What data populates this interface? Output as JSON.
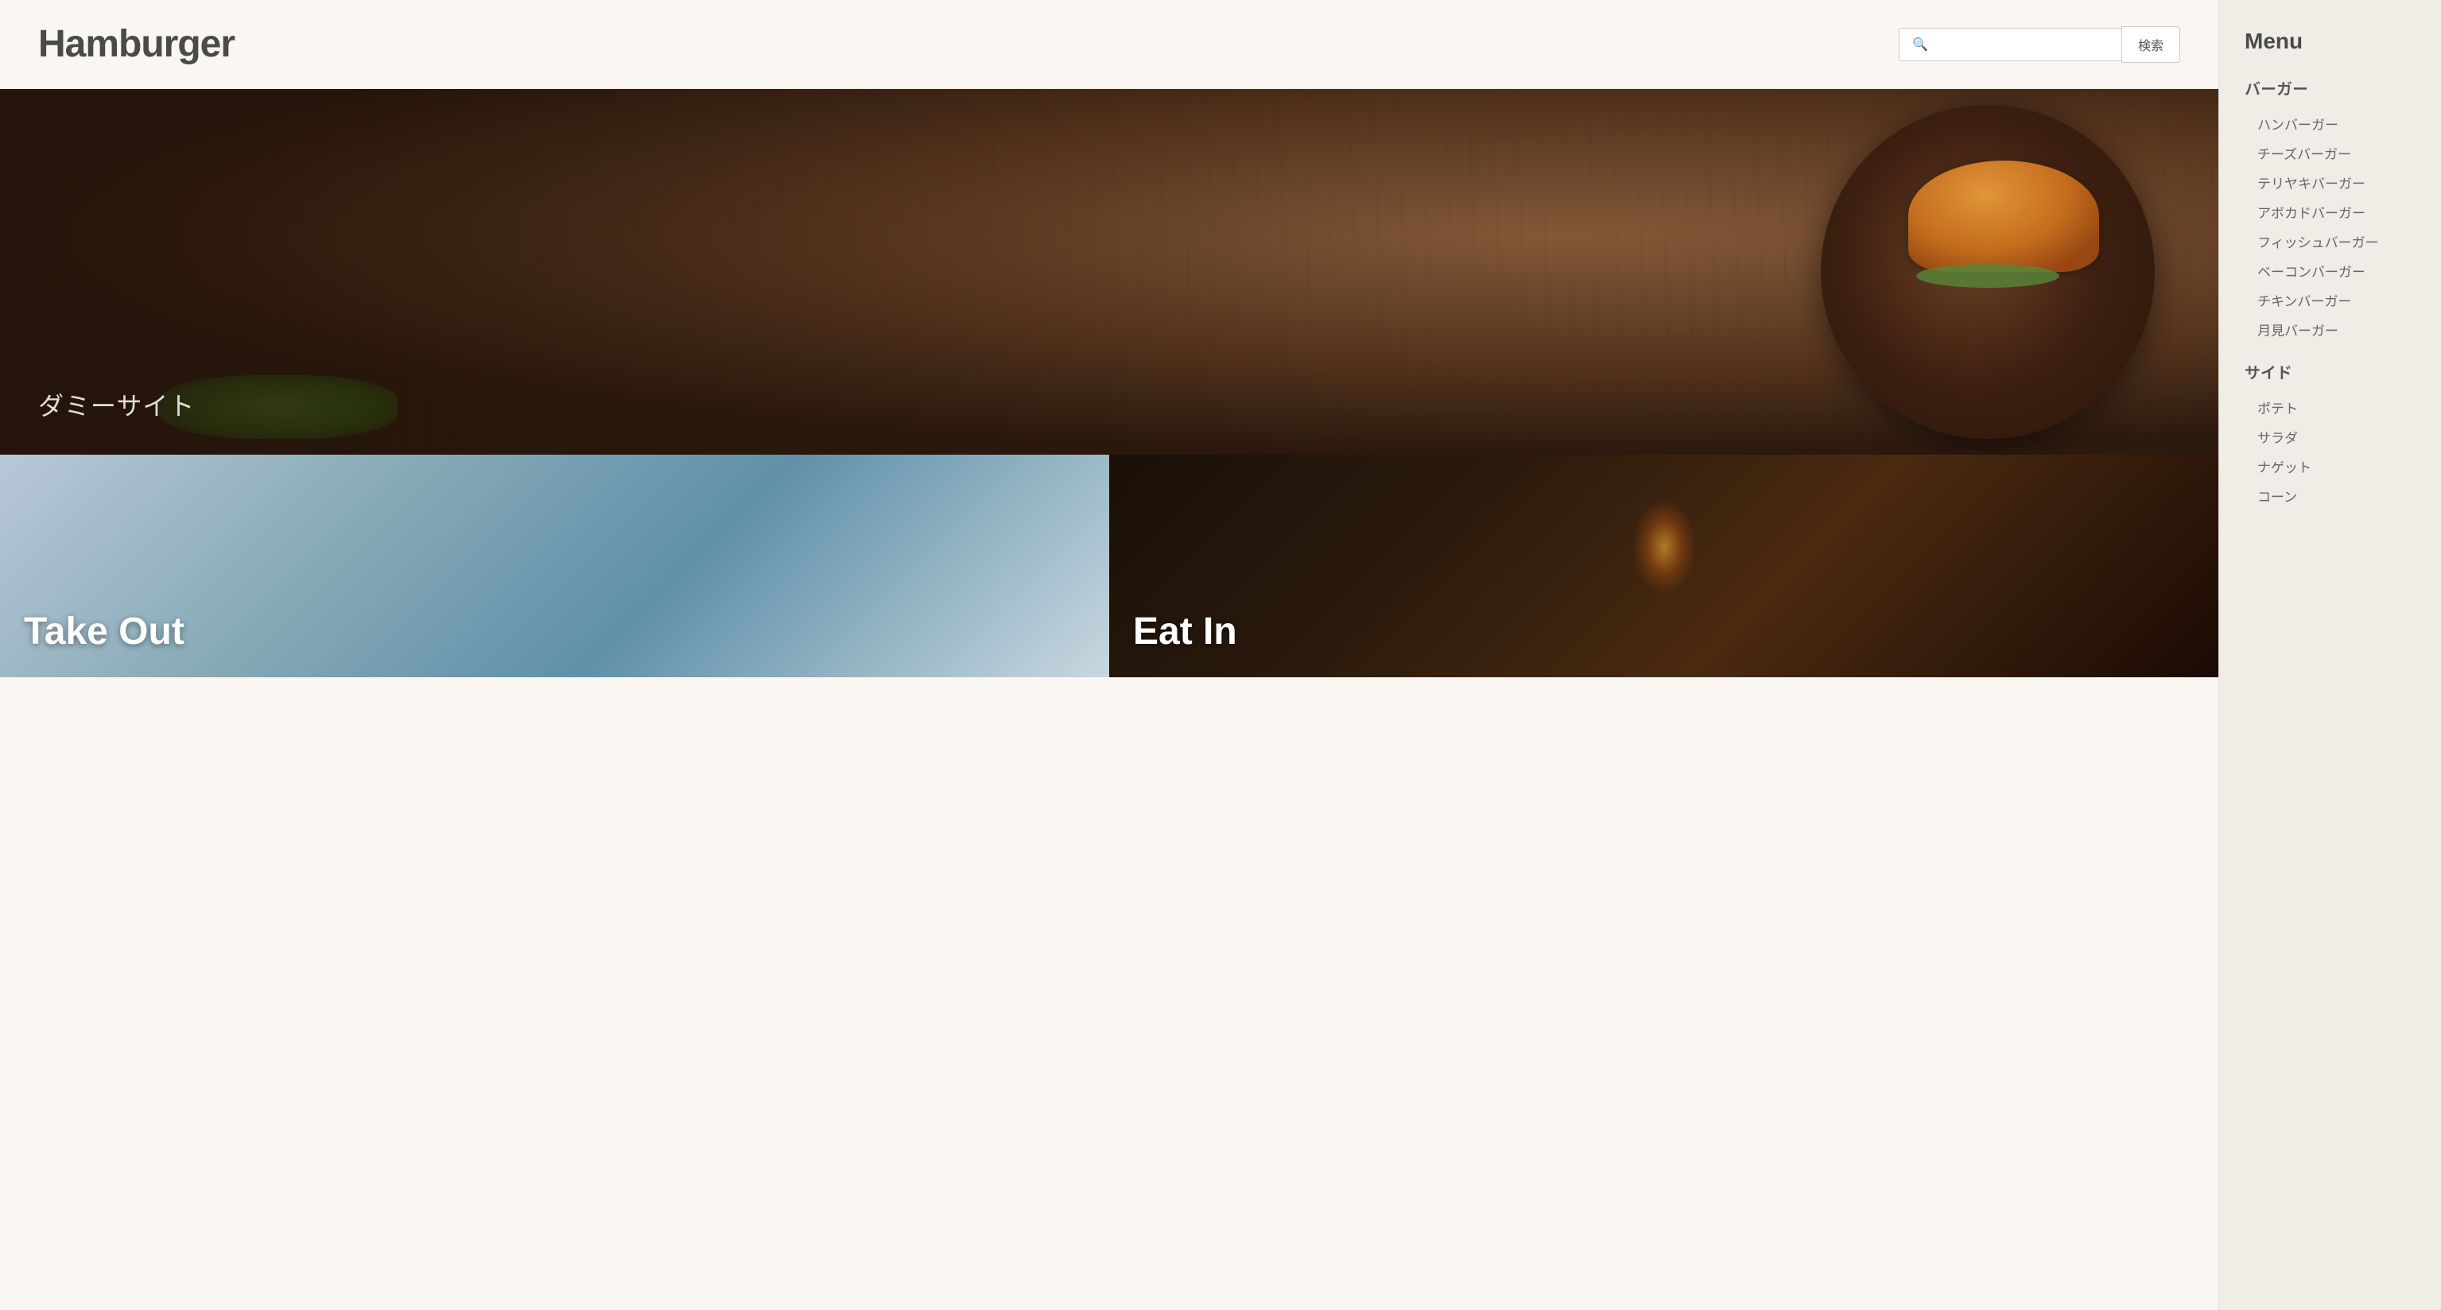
{
  "header": {
    "site_title": "Hamburger",
    "search_placeholder": "",
    "search_button_label": "検索"
  },
  "hero": {
    "overlay_text": "ダミーサイト"
  },
  "cards": [
    {
      "id": "takeout",
      "label": "Take Out"
    },
    {
      "id": "eatin",
      "label": "Eat In"
    }
  ],
  "sidebar": {
    "title": "Menu",
    "categories": [
      {
        "name": "バーガー",
        "items": [
          "ハンバーガー",
          "チーズバーガー",
          "テリヤキバーガー",
          "アボカドバーガー",
          "フィッシュバーガー",
          "ベーコンバーガー",
          "チキンバーガー",
          "月見バーガー"
        ]
      },
      {
        "name": "サイド",
        "items": [
          "ポテト",
          "サラダ",
          "ナゲット",
          "コーン"
        ]
      }
    ]
  }
}
